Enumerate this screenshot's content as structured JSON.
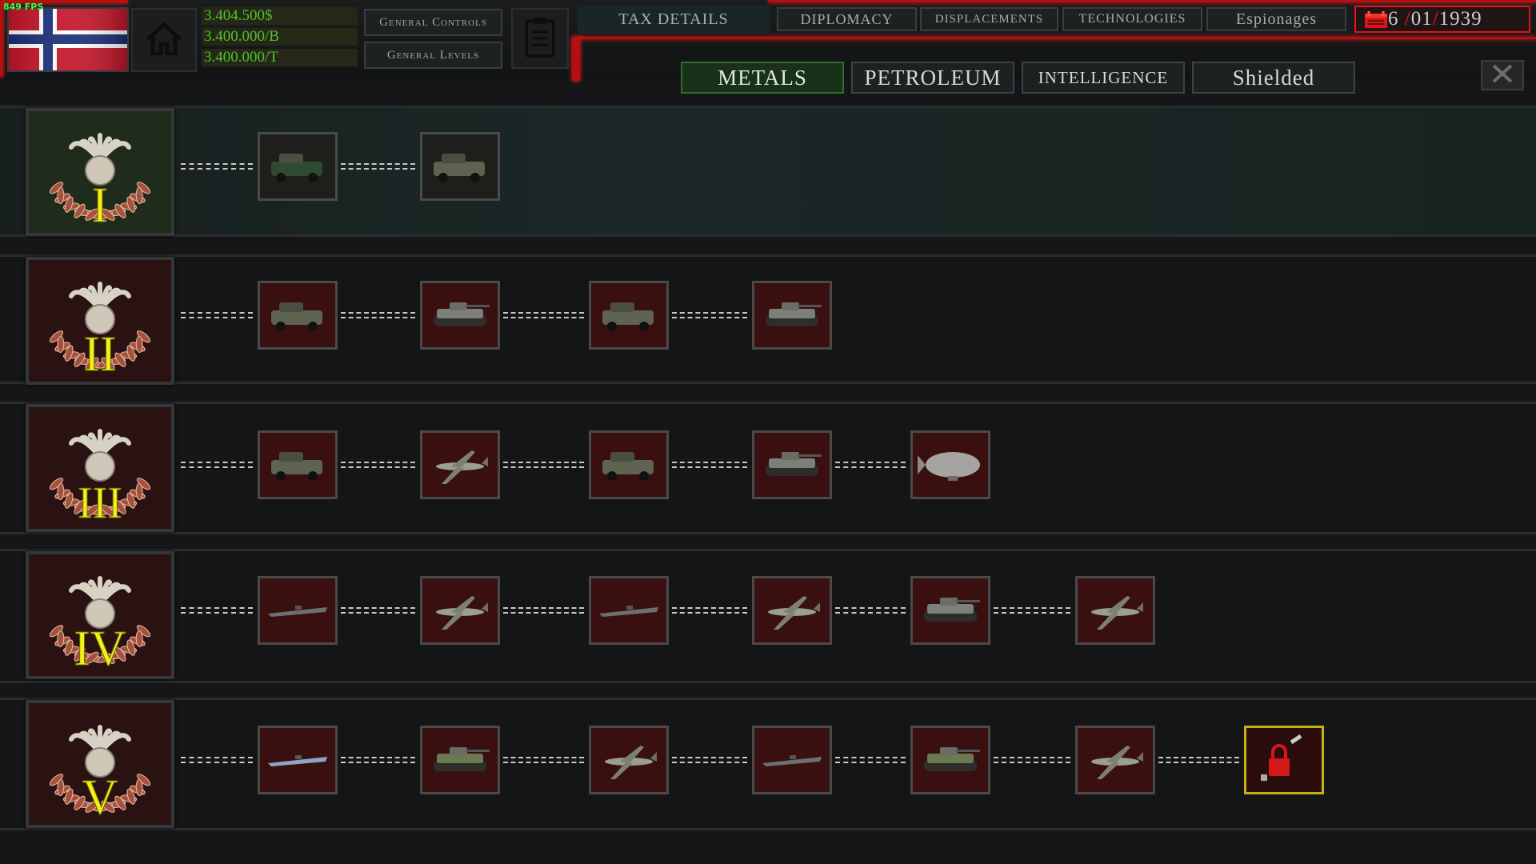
{
  "fps": "849 FPS",
  "resources": {
    "money": "3.404.500$",
    "per_b": "3.400.000/B",
    "per_t": "3.400.000/T"
  },
  "general_buttons": {
    "controls": "General Controls",
    "levels": "General Levels"
  },
  "tax_title": "TAX DETAILS",
  "nav_tabs": [
    "DIPLOMACY",
    "DISPLACEMENTS",
    "TECHNOLOGIES",
    "Espionages"
  ],
  "date": {
    "day": "6",
    "month": "01",
    "year": "1939"
  },
  "resource_tabs": [
    "METALS",
    "PETROLEUM",
    "INTELLIGENCE",
    "Shielded"
  ],
  "ranks": [
    {
      "numeral": "I",
      "units": [
        "car",
        "scout-car"
      ]
    },
    {
      "numeral": "II",
      "units": [
        "jeep",
        "light-tank",
        "supply-truck",
        "medium-tank"
      ]
    },
    {
      "numeral": "III",
      "units": [
        "half-track",
        "fighter-plane",
        "armored-carrier",
        "heavy-tank",
        "airship"
      ]
    },
    {
      "numeral": "IV",
      "units": [
        "submarine",
        "bomber-plane",
        "landing-craft",
        "fighter-p51",
        "assault-gun",
        "spitfire"
      ]
    },
    {
      "numeral": "V",
      "units": [
        "submarine-blue",
        "tank-camo",
        "fighter-bf109",
        "destroyer",
        "tank-star",
        "twin-engine-fighter",
        "locked"
      ]
    }
  ],
  "colors": {
    "accent_red": "#e01515",
    "active_green": "#2f6d2f",
    "numeral_yellow": "#f2f21a",
    "lock_gold": "#c4b215"
  }
}
